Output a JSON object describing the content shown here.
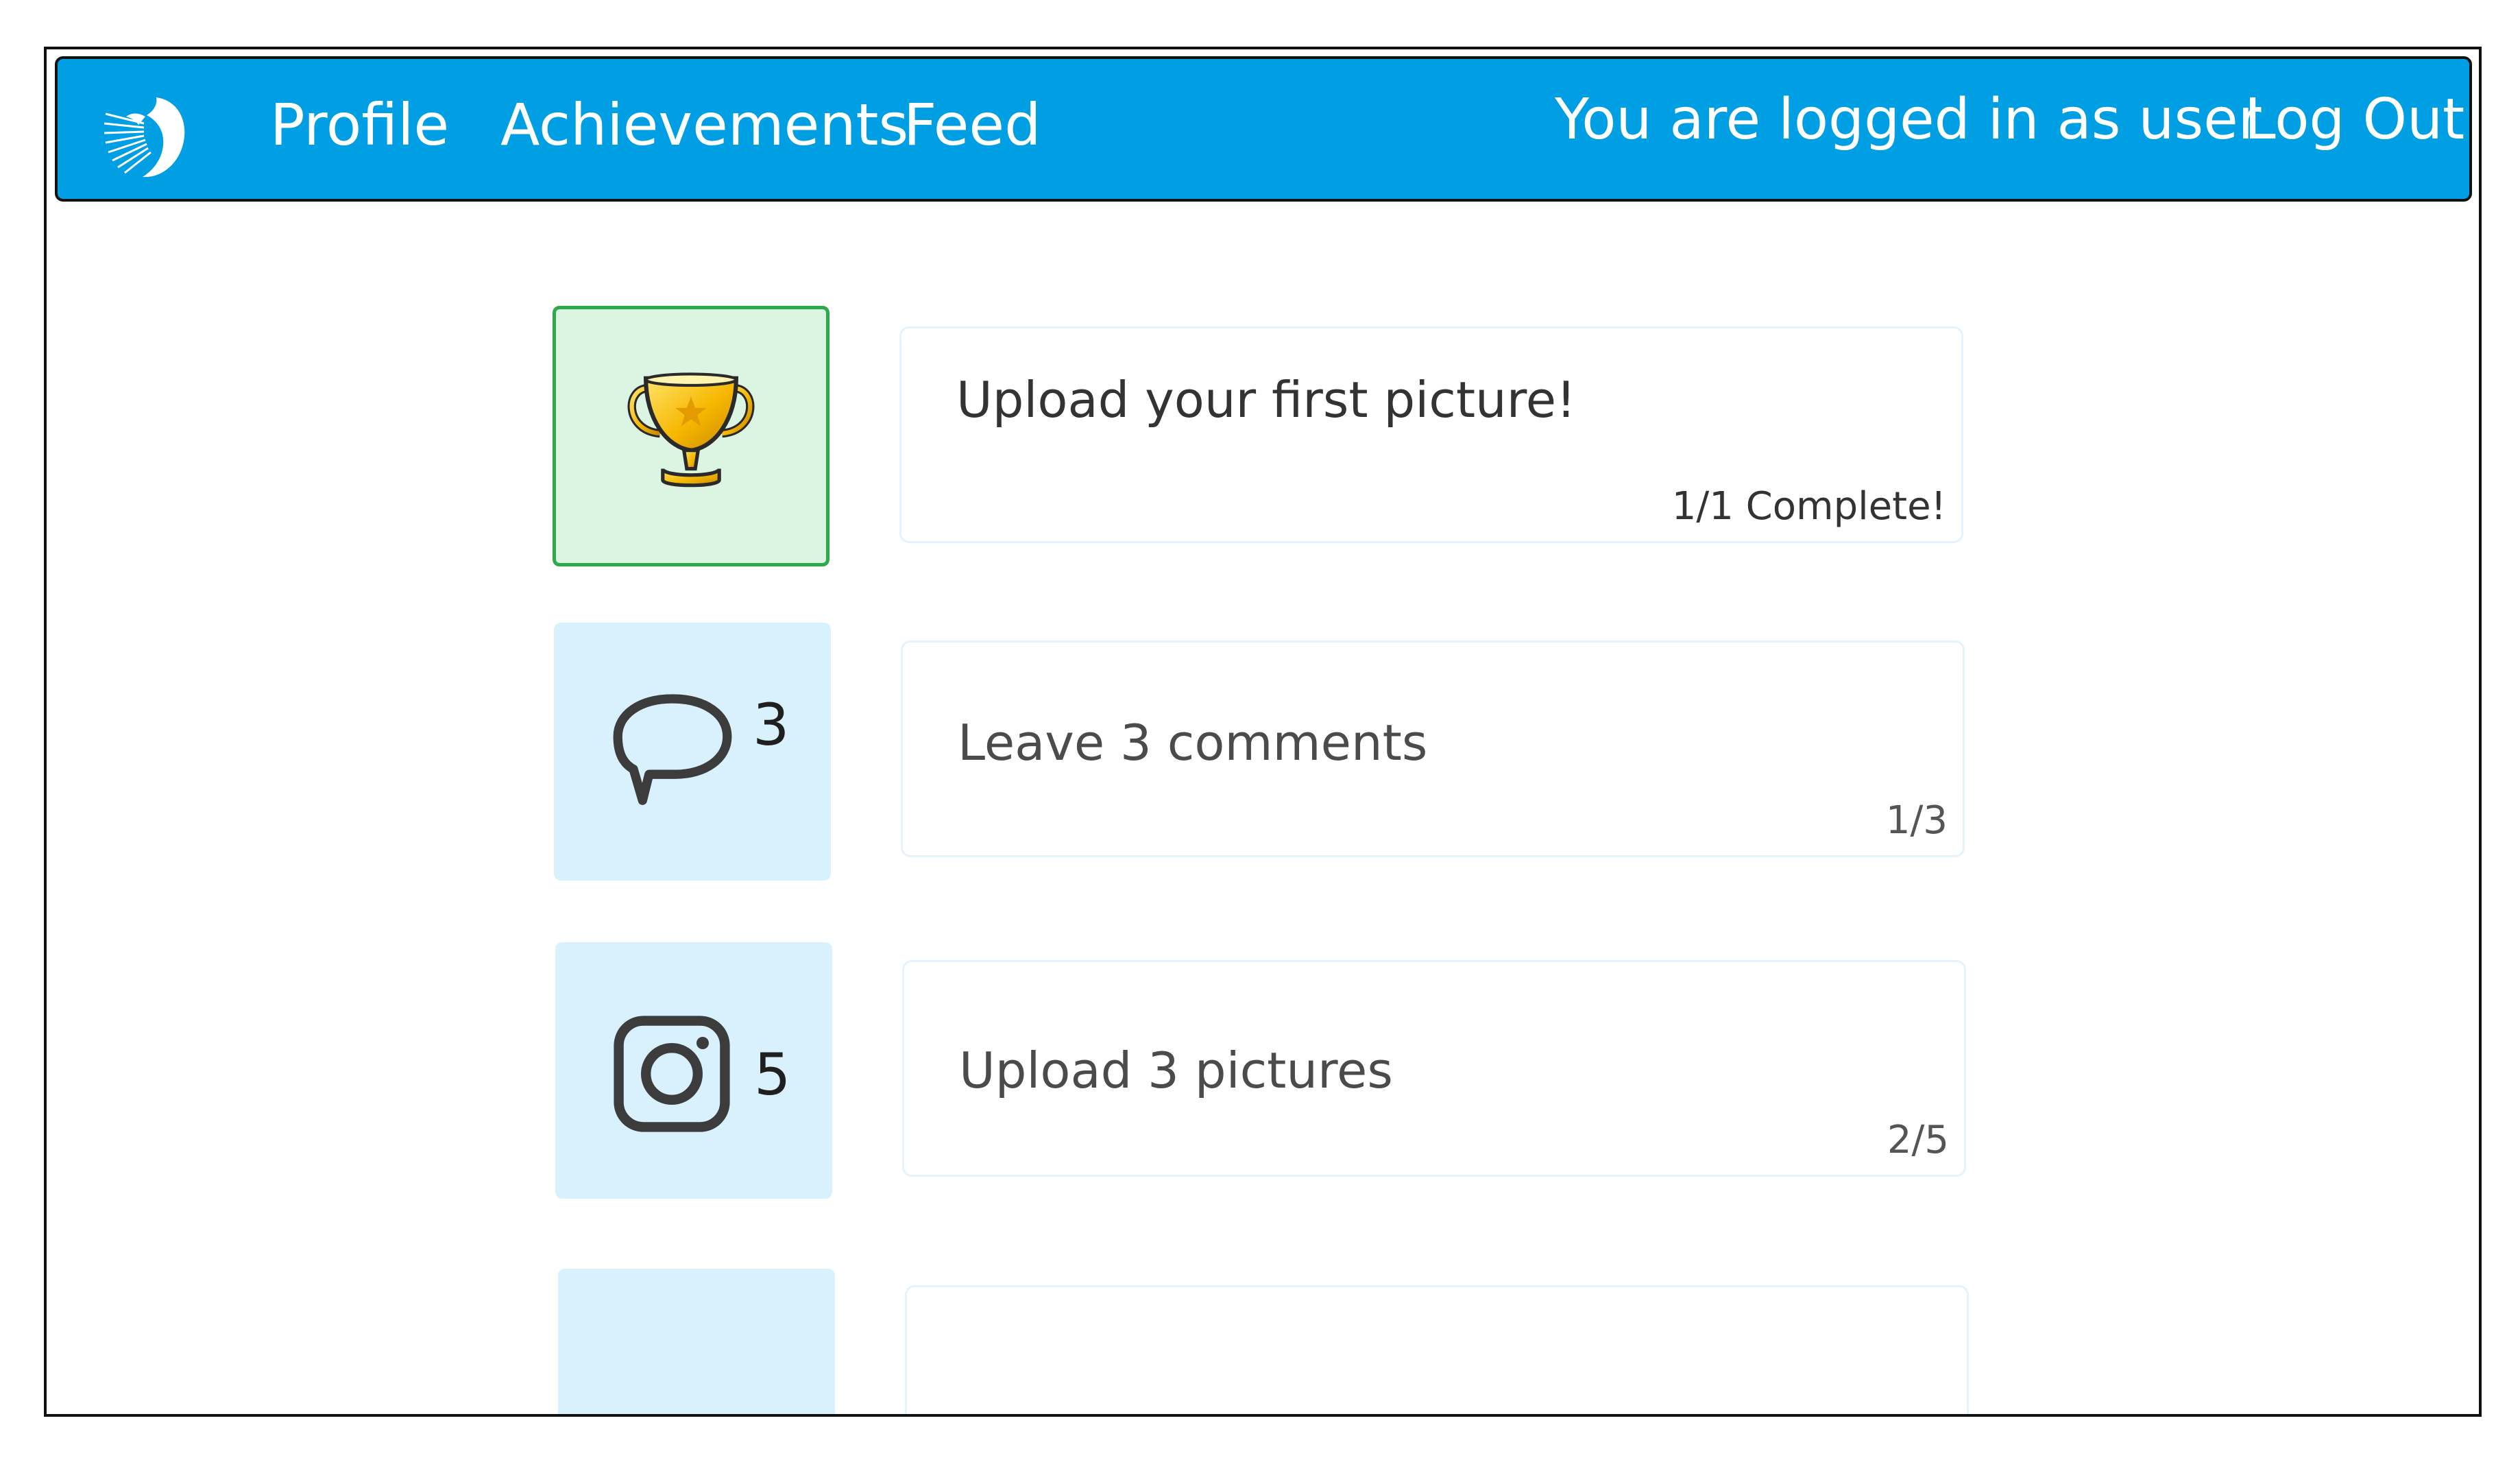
{
  "header": {
    "nav": [
      "Profile",
      "Achievements",
      "Feed"
    ],
    "login_status": "You are logged in as user",
    "logout_label": "Log Out",
    "logo_icon": "bird-logo-icon"
  },
  "colors": {
    "navbar": "#009fe3",
    "tile_default": "#d8f1fd",
    "tile_complete": "#dcf5e3",
    "tile_complete_border": "#2eaa4d"
  },
  "achievements": [
    {
      "title": "Upload your first picture!",
      "progress": "1/1 Complete!",
      "icon": "trophy-icon",
      "badge": "",
      "completed": true
    },
    {
      "title": "Leave 3 comments",
      "progress": "1/3",
      "icon": "speech-bubble-icon",
      "badge": "3",
      "completed": false
    },
    {
      "title": "Upload 3 pictures",
      "progress": "2/5",
      "icon": "camera-icon",
      "badge": "5",
      "completed": false
    },
    {
      "title": "",
      "progress": "",
      "icon": "",
      "badge": "",
      "completed": false
    }
  ]
}
